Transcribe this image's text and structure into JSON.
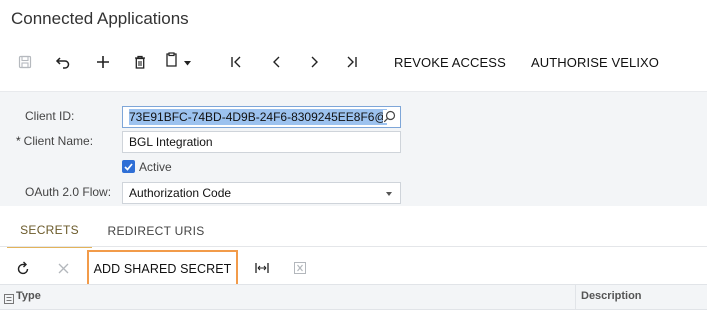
{
  "page": {
    "title": "Connected Applications"
  },
  "toolbar": {
    "save_icon": "save-icon",
    "undo_icon": "undo-icon",
    "add_icon": "plus-icon",
    "delete_icon": "trash-icon",
    "copy_icon": "clipboard-icon",
    "first_icon": "first-page-icon",
    "prev_icon": "previous-icon",
    "next_icon": "next-icon",
    "last_icon": "last-page-icon",
    "revoke_label": "REVOKE ACCESS",
    "authorise_label": "AUTHORISE VELIXO"
  },
  "form": {
    "client_id": {
      "label": "Client ID:",
      "value": "73E91BFC-74BD-4D9B-24F6-8309245EE8F6@"
    },
    "client_name": {
      "label": "Client Name:",
      "required_mark": "*",
      "value": "BGL Integration"
    },
    "active": {
      "label": "Active",
      "checked": true
    },
    "oauth_flow": {
      "label": "OAuth 2.0 Flow:",
      "value": "Authorization Code"
    }
  },
  "tabs": [
    {
      "label": "SECRETS",
      "active": true
    },
    {
      "label": "REDIRECT URIS",
      "active": false
    }
  ],
  "grid_toolbar": {
    "refresh_icon": "refresh-icon",
    "cancel_icon": "close-icon",
    "add_shared_secret_label": "ADD SHARED SECRET",
    "fit_icon": "fit-columns-icon",
    "excel_icon": "excel-export-icon"
  },
  "grid": {
    "columns": [
      "Type",
      "Description"
    ]
  },
  "colors": {
    "accent_blue": "#2f6fd6",
    "selection": "#9cc2ef",
    "highlight_border": "#f29b4a",
    "tab_underline": "#e3b35a",
    "panel_bg": "#f3f5f7"
  }
}
